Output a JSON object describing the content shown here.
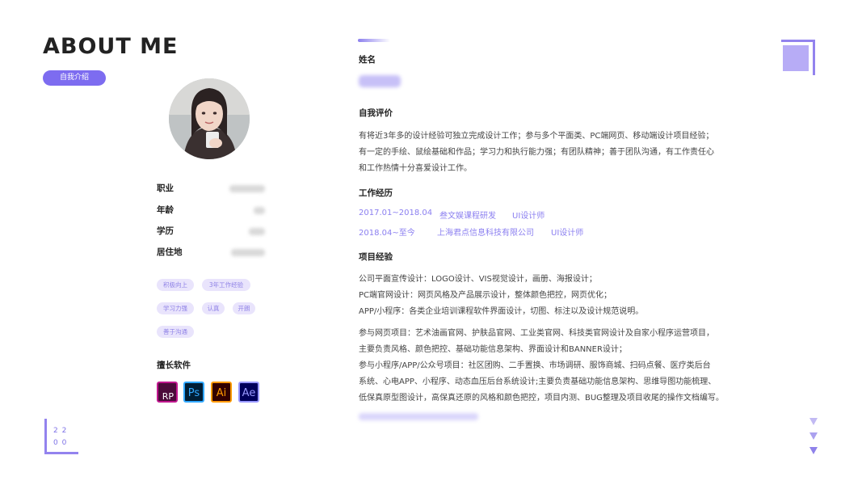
{
  "title": "ABOUT ME",
  "intro_label": "自我介绍",
  "info": [
    {
      "key": "职业",
      "value": ""
    },
    {
      "key": "年龄",
      "value": ""
    },
    {
      "key": "学历",
      "value": ""
    },
    {
      "key": "居住地",
      "value": ""
    }
  ],
  "tags": [
    "积极向上",
    "3年工作经验",
    "学习力强",
    "认真",
    "开朗",
    "善于沟通"
  ],
  "software_heading": "擅长软件",
  "software": [
    {
      "label": "RP",
      "color": "#c0178e"
    },
    {
      "label": "Ps",
      "color": "#31a8ff"
    },
    {
      "label": "Ai",
      "color": "#ff9a00"
    },
    {
      "label": "Ae",
      "color": "#9999ff"
    }
  ],
  "year": {
    "line1": "2 2",
    "line2": "0 0"
  },
  "name_heading": "姓名",
  "name_value": "",
  "self_eval": {
    "heading": "自我评价",
    "lines": [
      "有将近3年多的设计经验可独立完成设计工作；参与多个平面类、PC端网页、移动端设计项目经验；",
      "有一定的手绘、鼠绘基础和作品；学习力和执行能力强；有团队精神；善于团队沟通，有工作责任心",
      "和工作热情十分喜爱设计工作。"
    ]
  },
  "work": {
    "heading": "工作经历",
    "items": [
      {
        "period": "2017.01~2018.04",
        "company": "叁文娱课程研发",
        "role": "UI设计师"
      },
      {
        "period": "2018.04~至今",
        "company": "上海君点信息科技有限公司",
        "role": "UI设计师"
      }
    ]
  },
  "projects": {
    "heading": "项目经验",
    "group1": [
      "公司平面宣传设计：LOGO设计、VIS视觉设计，画册、海报设计；",
      "PC端官网设计：网页风格及产品展示设计，整体颜色把控，网页优化；",
      "APP/小程序：各类企业培训课程软件界面设计，切图、标注以及设计规范说明。"
    ],
    "group2": [
      "参与网页项目：艺术油画官网、护肤品官网、工业类官网、科技类官网设计及自家小程序运营项目，",
      "主要负责风格、颜色把控、基础功能信息架构、界面设计和BANNER设计；",
      "参与小程序/APP/公众号项目：社区团购、二手置换、市场调研、服饰商城、扫码点餐、医疗类后台",
      "系统、心电APP、小程序、动态血压后台系统设计;主要负责基础功能信息架构、思维导图功能梳理、",
      "低保真原型图设计，高保真还原的风格和颜色把控，项目内测、BUG整理及项目收尾的操作文档编写。"
    ]
  },
  "colors": {
    "accent": "#7d6cf0",
    "accent_light": "#e9e4fc",
    "link": "#8b7ff0"
  }
}
